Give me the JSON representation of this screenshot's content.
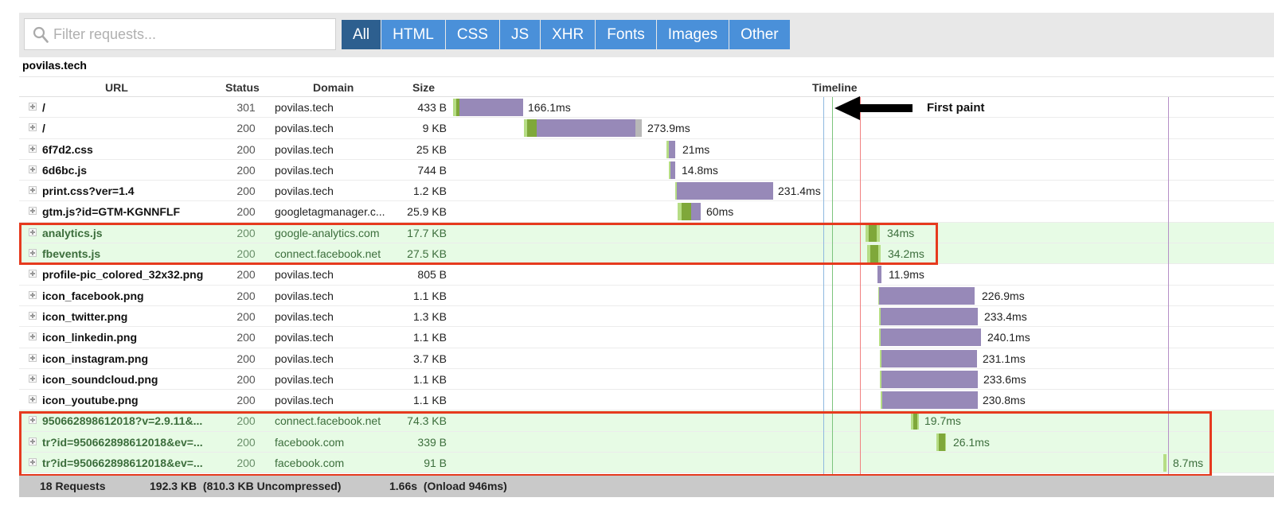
{
  "search": {
    "placeholder": "Filter requests..."
  },
  "filters": [
    {
      "label": "All",
      "active": true
    },
    {
      "label": "HTML"
    },
    {
      "label": "CSS"
    },
    {
      "label": "JS"
    },
    {
      "label": "XHR"
    },
    {
      "label": "Fonts"
    },
    {
      "label": "Images"
    },
    {
      "label": "Other"
    }
  ],
  "site": "povilas.tech",
  "columns": {
    "url": "URL",
    "status": "Status",
    "domain": "Domain",
    "size": "Size",
    "timeline": "Timeline"
  },
  "annotation": {
    "first_paint": "First paint"
  },
  "colors": {
    "receive": "#9789b8",
    "wait": "#7fa83a",
    "connect": "#b6dd85",
    "highlight_border": "#e63a1e",
    "highlight_row": "#e7fbe5"
  },
  "rows": [
    {
      "url": "/",
      "status": "301",
      "domain": "povilas.tech",
      "size": "433 B",
      "duration": "166.1ms",
      "highlight": false
    },
    {
      "url": "/",
      "status": "200",
      "domain": "povilas.tech",
      "size": "9 KB",
      "duration": "273.9ms",
      "highlight": false
    },
    {
      "url": "6f7d2.css",
      "status": "200",
      "domain": "povilas.tech",
      "size": "25 KB",
      "duration": "21ms",
      "highlight": false
    },
    {
      "url": "6d6bc.js",
      "status": "200",
      "domain": "povilas.tech",
      "size": "744 B",
      "duration": "14.8ms",
      "highlight": false
    },
    {
      "url": "print.css?ver=1.4",
      "status": "200",
      "domain": "povilas.tech",
      "size": "1.2 KB",
      "duration": "231.4ms",
      "highlight": false
    },
    {
      "url": "gtm.js?id=GTM-KGNNFLF",
      "status": "200",
      "domain": "googletagmanager.c...",
      "size": "25.9 KB",
      "duration": "60ms",
      "highlight": false
    },
    {
      "url": "analytics.js",
      "status": "200",
      "domain": "google-analytics.com",
      "size": "17.7 KB",
      "duration": "34ms",
      "highlight": true
    },
    {
      "url": "fbevents.js",
      "status": "200",
      "domain": "connect.facebook.net",
      "size": "27.5 KB",
      "duration": "34.2ms",
      "highlight": true
    },
    {
      "url": "profile-pic_colored_32x32.png",
      "status": "200",
      "domain": "povilas.tech",
      "size": "805 B",
      "duration": "11.9ms",
      "highlight": false
    },
    {
      "url": "icon_facebook.png",
      "status": "200",
      "domain": "povilas.tech",
      "size": "1.1 KB",
      "duration": "226.9ms",
      "highlight": false
    },
    {
      "url": "icon_twitter.png",
      "status": "200",
      "domain": "povilas.tech",
      "size": "1.3 KB",
      "duration": "233.4ms",
      "highlight": false
    },
    {
      "url": "icon_linkedin.png",
      "status": "200",
      "domain": "povilas.tech",
      "size": "1.1 KB",
      "duration": "240.1ms",
      "highlight": false
    },
    {
      "url": "icon_instagram.png",
      "status": "200",
      "domain": "povilas.tech",
      "size": "3.7 KB",
      "duration": "231.1ms",
      "highlight": false
    },
    {
      "url": "icon_soundcloud.png",
      "status": "200",
      "domain": "povilas.tech",
      "size": "1.1 KB",
      "duration": "233.6ms",
      "highlight": false
    },
    {
      "url": "icon_youtube.png",
      "status": "200",
      "domain": "povilas.tech",
      "size": "1.1 KB",
      "duration": "230.8ms",
      "highlight": false
    },
    {
      "url": "950662898612018?v=2.9.11&...",
      "status": "200",
      "domain": "connect.facebook.net",
      "size": "74.3 KB",
      "duration": "19.7ms",
      "highlight": true
    },
    {
      "url": "tr?id=950662898612018&ev=...",
      "status": "200",
      "domain": "facebook.com",
      "size": "339 B",
      "duration": "26.1ms",
      "highlight": true
    },
    {
      "url": "tr?id=950662898612018&ev=...",
      "status": "200",
      "domain": "facebook.com",
      "size": "91 B",
      "duration": "8.7ms",
      "highlight": true
    }
  ],
  "footer": {
    "requests": "18 Requests",
    "size": "192.3 KB  (810.3 KB Uncompressed)",
    "time": "1.66s  (Onload 946ms)"
  }
}
